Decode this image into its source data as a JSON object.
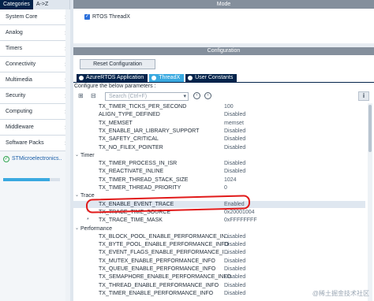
{
  "left": {
    "tabs": [
      "Categories",
      "A->Z"
    ],
    "categories": [
      "System Core",
      "Analog",
      "Timers",
      "Connectivity",
      "Multimedia",
      "Security",
      "Computing",
      "Middleware",
      "Software Packs"
    ],
    "sub_item": "STMicroelectronics..",
    "progress": 0.82
  },
  "mode": {
    "title": "Mode",
    "checkbox_label": "RTOS ThreadX",
    "checked": true
  },
  "configuration": {
    "title": "Configuration",
    "reset_label": "Reset Configuration",
    "tabs": [
      {
        "label": "AzureRTOS Application",
        "active": false
      },
      {
        "label": "ThreadX",
        "active": true
      },
      {
        "label": "User Constants",
        "active": false
      }
    ],
    "below_text": "Configure the below parameters :",
    "search_placeholder": "Search (Ctrl+F)",
    "info_icon": "i"
  },
  "params": [
    {
      "kind": "row",
      "name": "TX_TIMER_TICKS_PER_SECOND",
      "value": "100"
    },
    {
      "kind": "row",
      "name": "ALIGN_TYPE_DEFINED",
      "value": "Disabled"
    },
    {
      "kind": "row",
      "name": "TX_MEMSET",
      "value": "memset"
    },
    {
      "kind": "row",
      "name": "TX_ENABLE_IAR_LIBRARY_SUPPORT",
      "value": "Disabled"
    },
    {
      "kind": "row",
      "name": "TX_SAFETY_CRITICAL",
      "value": "Disabled"
    },
    {
      "kind": "row",
      "name": "TX_NO_FILEX_POINTER",
      "value": "Disabled"
    },
    {
      "kind": "group",
      "name": "Timer"
    },
    {
      "kind": "row",
      "name": "TX_TIMER_PROCESS_IN_ISR",
      "value": "Disabled"
    },
    {
      "kind": "row",
      "name": "TX_REACTIVATE_INLINE",
      "value": "Disabled"
    },
    {
      "kind": "row",
      "name": "TX_TIMER_THREAD_STACK_SIZE",
      "value": "1024"
    },
    {
      "kind": "row",
      "name": "TX_TIMER_THREAD_PRIORITY",
      "value": "0"
    },
    {
      "kind": "group",
      "name": "Trace"
    },
    {
      "kind": "row",
      "name": "TX_ENABLE_EVENT_TRACE",
      "value": "Enabled",
      "highlight": true
    },
    {
      "kind": "row",
      "name": "TX_TRACE_TIME_SOURCE",
      "value": "0x20001004",
      "star": true
    },
    {
      "kind": "row",
      "name": "TX_TRACE_TIME_MASK",
      "value": "0xFFFFFFFF",
      "star": true
    },
    {
      "kind": "group",
      "name": "Performance"
    },
    {
      "kind": "row",
      "name": "TX_BLOCK_POOL_ENABLE_PERFORMANCE_IN...",
      "value": "Disabled"
    },
    {
      "kind": "row",
      "name": "TX_BYTE_POOL_ENABLE_PERFORMANCE_INFO",
      "value": "Disabled"
    },
    {
      "kind": "row",
      "name": "TX_EVENT_FLAGS_ENABLE_PERFORMANCE_I...",
      "value": "Disabled"
    },
    {
      "kind": "row",
      "name": "TX_MUTEX_ENABLE_PERFORMANCE_INFO",
      "value": "Disabled"
    },
    {
      "kind": "row",
      "name": "TX_QUEUE_ENABLE_PERFORMANCE_INFO",
      "value": "Disabled"
    },
    {
      "kind": "row",
      "name": "TX_SEMAPHORE_ENABLE_PERFORMANCE_INFO",
      "value": "Disabled"
    },
    {
      "kind": "row",
      "name": "TX_THREAD_ENABLE_PERFORMANCE_INFO",
      "value": "Disabled"
    },
    {
      "kind": "row",
      "name": "TX_TIMER_ENABLE_PERFORMANCE_INFO",
      "value": "Disabled"
    }
  ],
  "watermark": "@稀土掘金技术社区",
  "annotation_color": "#e11a1a"
}
